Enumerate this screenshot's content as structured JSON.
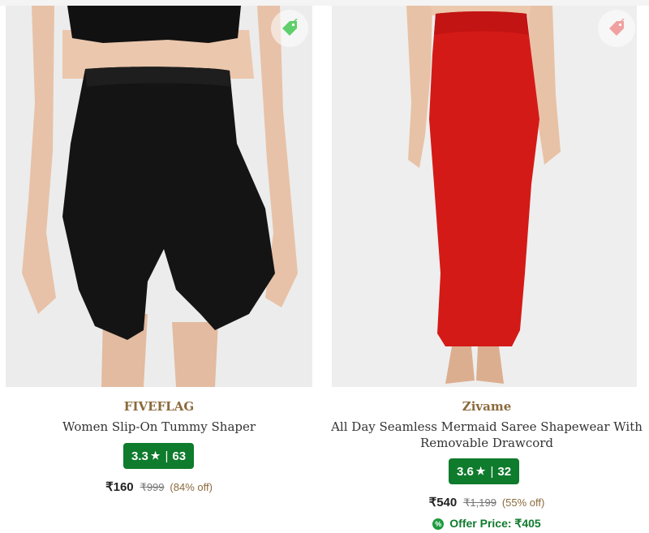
{
  "products": [
    {
      "brand": "FIVEFLAG",
      "title": "Women Slip-On Tummy Shaper",
      "rating": "3.3",
      "rating_count": "63",
      "price": "₹160",
      "mrp": "₹999",
      "discount": "(84% off)",
      "image_icon": "black-shapewear-shorts",
      "tag_icon": "green-price-tag-icon",
      "tag_color": "#5fcf6b"
    },
    {
      "brand": "Zivame",
      "title": "All Day Seamless Mermaid Saree Shapewear With Removable Drawcord",
      "rating": "3.6",
      "rating_count": "32",
      "price": "₹540",
      "mrp": "₹1,199",
      "discount": "(55% off)",
      "offer_label": "Offer Price: ₹405",
      "image_icon": "red-saree-shapewear",
      "tag_icon": "pink-price-tag-icon",
      "tag_color": "#f0a0a0"
    }
  ],
  "colors": {
    "rating_badge": "#0f7b2d",
    "brand_text": "#8b6a3c",
    "offer_text": "#0f7b2d"
  }
}
